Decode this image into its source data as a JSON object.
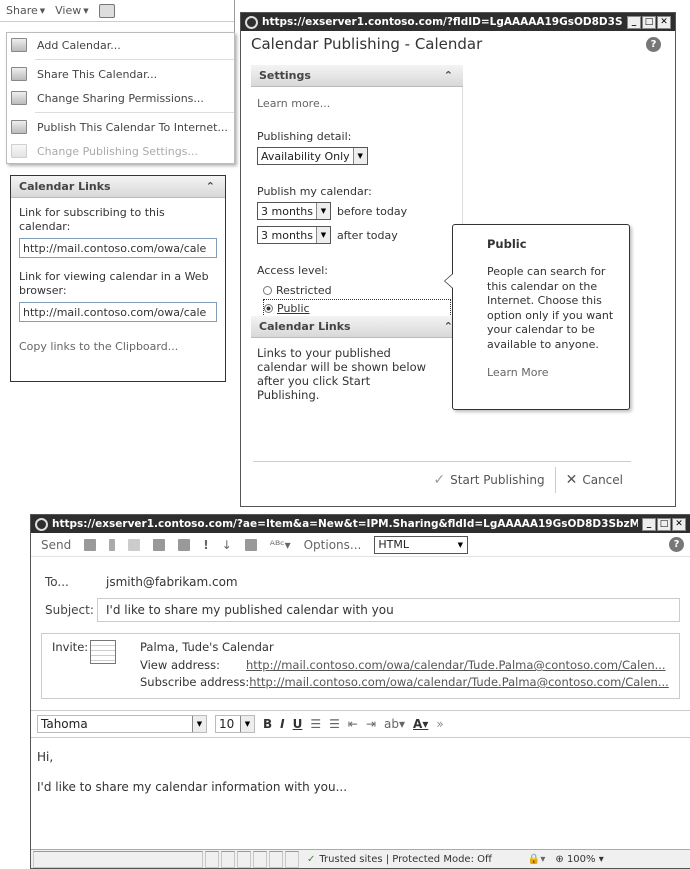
{
  "menu_window": {
    "toolbar": {
      "share": "Share",
      "view": "View"
    },
    "menu_items": [
      {
        "label": "Add Calendar...",
        "icon": "add-calendar-icon",
        "disabled": false
      },
      {
        "label": "Share This Calendar...",
        "icon": "share-calendar-icon",
        "disabled": false
      },
      {
        "label": "Change Sharing Permissions...",
        "icon": "permissions-icon",
        "disabled": false
      },
      {
        "label": "Publish This Calendar To Internet...",
        "icon": "publish-icon",
        "disabled": false
      },
      {
        "label": "Change Publishing Settings...",
        "icon": "publishing-settings-icon",
        "disabled": true
      }
    ]
  },
  "links_panel": {
    "title": "Calendar Links",
    "subscribe_label": "Link for subscribing to this calendar:",
    "subscribe_value": "http://mail.contoso.com/owa/cale",
    "view_label": "Link for viewing calendar in a Web browser:",
    "view_value": "http://mail.contoso.com/owa/cale",
    "copy_link": "Copy links to the Clipboard..."
  },
  "publish_window": {
    "url": "https://exserver1.contoso.com/?fldID=LgAAAAA19GsOD8D3Sbz...",
    "title": "Calendar Publishing - Calendar",
    "settings_header": "Settings",
    "learn_more": "Learn more...",
    "publishing_detail_label": "Publishing detail:",
    "publishing_detail_value": "Availability Only",
    "publish_my_calendar_label": "Publish my calendar:",
    "before_value": "3 months",
    "before_suffix": "before today",
    "after_value": "3 months",
    "after_suffix": "after today",
    "access_level_label": "Access level:",
    "access_options": [
      "Restricted",
      "Public"
    ],
    "selected_access": "Public",
    "links_header": "Calendar Links",
    "links_text": "Links to your published calendar will be shown below after you click Start Publishing.",
    "start_button": "Start Publishing",
    "cancel_button": "Cancel"
  },
  "callout": {
    "title": "Public",
    "body": "People can search for this calendar on the Internet. Choose this option only if you want your calendar to be available to anyone.",
    "learn_more": "Learn More"
  },
  "mail_window": {
    "url": "https://exserver1.contoso.com/?ae=Item&a=New&t=IPM.Sharing&fldId=LgAAAAA19GsOD8D3SbzMtoSz...",
    "toolbar": {
      "send": "Send",
      "options": "Options...",
      "format": "HTML"
    },
    "to_label": "To...",
    "to_value": "jsmith@fabrikam.com",
    "subject_label": "Subject:",
    "subject_value": "I'd like to share my published calendar with you",
    "invite_label": "Invite:",
    "calendar_name": "Palma, Tude's Calendar",
    "view_address_label": "View address:",
    "view_address": "http://mail.contoso.com/owa/calendar/Tude.Palma@contoso.com/Calen...",
    "subscribe_address_label": "Subscribe address:",
    "subscribe_address": "http://mail.contoso.com/owa/calendar/Tude.Palma@contoso.com/Calen...",
    "font": "Tahoma",
    "size": "10",
    "body_greeting": "Hi,",
    "body_text": "I'd like to share my calendar information with you...",
    "status_text": "Trusted sites | Protected Mode: Off",
    "zoom": "100%"
  }
}
